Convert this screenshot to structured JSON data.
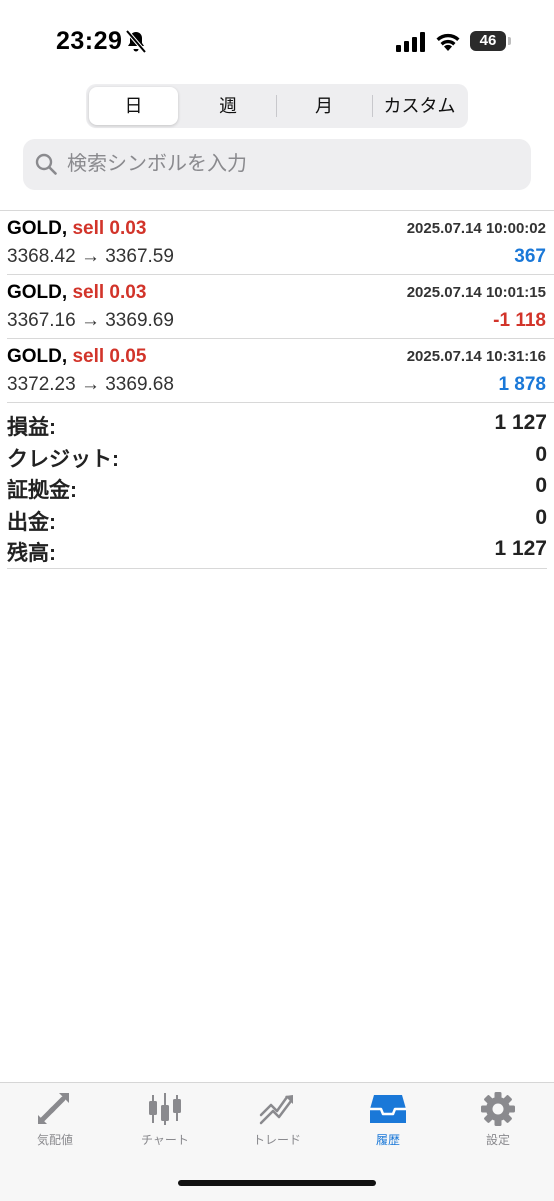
{
  "status_bar": {
    "time": "23:29",
    "battery": "46"
  },
  "period_tabs": [
    {
      "label": "日",
      "active": true
    },
    {
      "label": "週",
      "active": false
    },
    {
      "label": "月",
      "active": false
    },
    {
      "label": "カスタム",
      "active": false
    }
  ],
  "search": {
    "placeholder": "検索シンボルを入力"
  },
  "deals": [
    {
      "symbol": "GOLD,",
      "side": "sell 0.03",
      "time": "2025.07.14 10:00:02",
      "prices": "3368.42 → 3367.59",
      "profit": "367",
      "profit_sign": "positive"
    },
    {
      "symbol": "GOLD,",
      "side": "sell 0.03",
      "time": "2025.07.14 10:01:15",
      "prices": "3367.16 → 3369.69",
      "profit": "-1 118",
      "profit_sign": "negative"
    },
    {
      "symbol": "GOLD,",
      "side": "sell 0.05",
      "time": "2025.07.14 10:31:16",
      "prices": "3372.23 → 3369.68",
      "profit": "1 878",
      "profit_sign": "positive"
    }
  ],
  "summary": [
    {
      "label": "損益:",
      "value": "1 127"
    },
    {
      "label": "クレジット:",
      "value": "0"
    },
    {
      "label": "証拠金:",
      "value": "0"
    },
    {
      "label": "出金:",
      "value": "0"
    },
    {
      "label": "残高:",
      "value": "1 127"
    }
  ],
  "tab_bar": [
    {
      "label": "気配値",
      "icon": "quotes-arrows-icon",
      "active": false
    },
    {
      "label": "チャート",
      "icon": "candlestick-chart-icon",
      "active": false
    },
    {
      "label": "トレード",
      "icon": "trade-trend-icon",
      "active": false
    },
    {
      "label": "履歴",
      "icon": "history-inbox-icon",
      "active": true
    },
    {
      "label": "設定",
      "icon": "gear-icon",
      "active": false
    }
  ],
  "colors": {
    "accent": "#1a78d8",
    "loss": "#d2342a",
    "sell": "#d2342a",
    "inactive_tab": "#8a8a8e"
  }
}
